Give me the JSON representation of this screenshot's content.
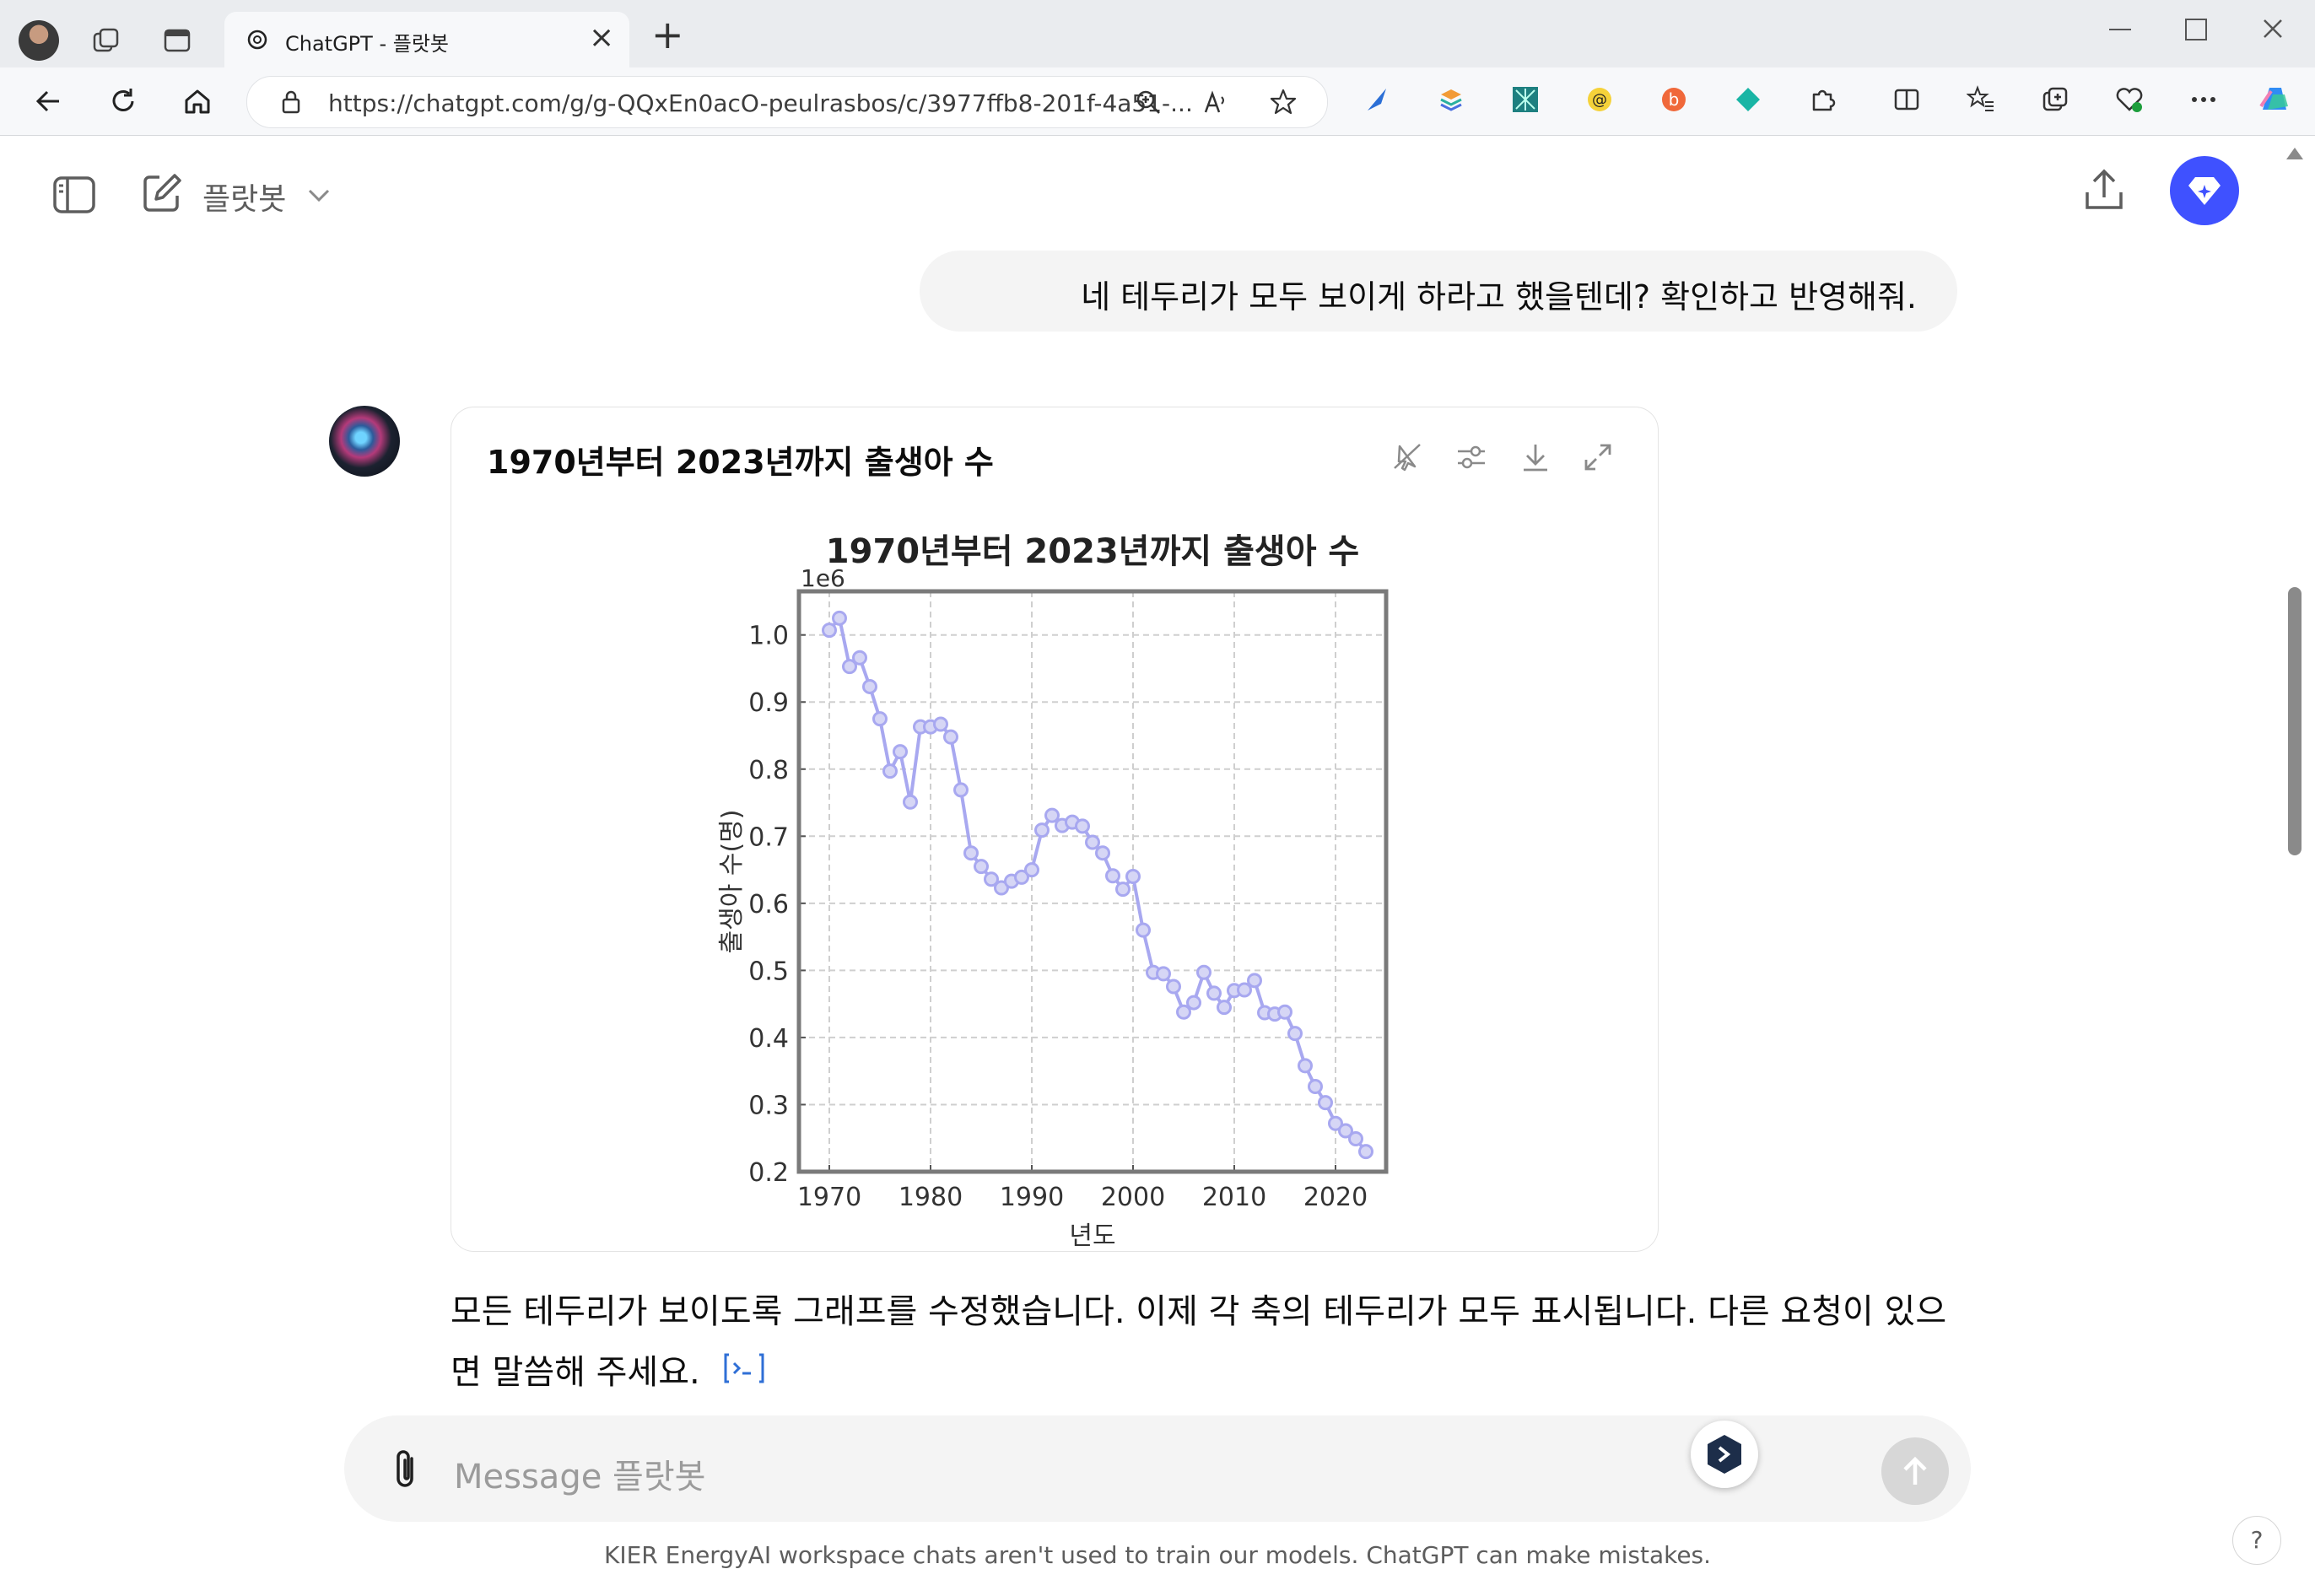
{
  "browser": {
    "tab_title": "ChatGPT - 플랏봇",
    "new_tab_symbol": "+",
    "close_tab_symbol": "×",
    "url": "https://chatgpt.com/g/g-QQxEn0acO-peulrasbos/c/3977ffb8-201f-4a51-..."
  },
  "header": {
    "gpt_name": "플랏봇"
  },
  "conversation": {
    "user_message": "네 테두리가 모두 보이게 하라고 했을텐데? 확인하고 반영해줘.",
    "card_title": "1970년부터 2023년까지 출생아 수",
    "assistant_reply": "모든 테두리가 보이도록 그래프를 수정했습니다. 이제 각 축의 테두리가 모두 표시됩니다. 다른 요청이 있으면 말씀해 주세요."
  },
  "composer": {
    "placeholder": "Message 플랏봇"
  },
  "footer": {
    "note": "KIER EnergyAI workspace chats aren't used to train our models. ChatGPT can make mistakes.",
    "help": "?"
  },
  "colors": {
    "accent": "#3f51ff",
    "line": "#a8a8f0",
    "marker_fill": "#d6d6f5"
  },
  "chart_data": {
    "type": "line",
    "title": "1970년부터 2023년까지 출생아 수",
    "xlabel": "년도",
    "ylabel": "출생아 수(명)",
    "y_scale_label": "1e6",
    "xlim": [
      1967,
      2025
    ],
    "ylim": [
      0.2,
      1.065
    ],
    "xticks": [
      1970,
      1980,
      1990,
      2000,
      2010,
      2020
    ],
    "yticks": [
      "0.2",
      "0.3",
      "0.4",
      "0.5",
      "0.6",
      "0.7",
      "0.8",
      "0.9",
      "1.0"
    ],
    "grid": true,
    "series": [
      {
        "x": [
          1970,
          1971,
          1972,
          1973,
          1974,
          1975,
          1976,
          1977,
          1978,
          1979,
          1980,
          1981,
          1982,
          1983,
          1984,
          1985,
          1986,
          1987,
          1988,
          1989,
          1990,
          1991,
          1992,
          1993,
          1994,
          1995,
          1996,
          1997,
          1998,
          1999,
          2000,
          2001,
          2002,
          2003,
          2004,
          2005,
          2006,
          2007,
          2008,
          2009,
          2010,
          2011,
          2012,
          2013,
          2014,
          2015,
          2016,
          2017,
          2018,
          2019,
          2020,
          2021,
          2022,
          2023
        ],
        "y": [
          1.007,
          1.025,
          0.953,
          0.966,
          0.923,
          0.875,
          0.797,
          0.826,
          0.751,
          0.863,
          0.863,
          0.867,
          0.848,
          0.769,
          0.675,
          0.655,
          0.636,
          0.623,
          0.633,
          0.639,
          0.65,
          0.709,
          0.731,
          0.716,
          0.721,
          0.715,
          0.691,
          0.675,
          0.641,
          0.621,
          0.64,
          0.56,
          0.497,
          0.495,
          0.476,
          0.438,
          0.452,
          0.497,
          0.466,
          0.445,
          0.47,
          0.471,
          0.485,
          0.437,
          0.435,
          0.438,
          0.406,
          0.358,
          0.327,
          0.303,
          0.272,
          0.261,
          0.249,
          0.23
        ]
      }
    ]
  }
}
